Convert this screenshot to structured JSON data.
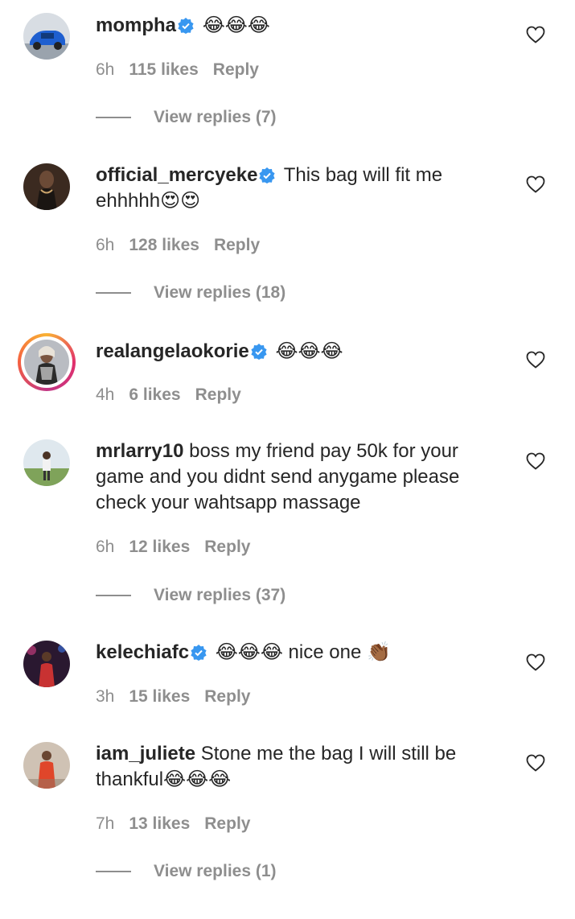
{
  "comments": [
    {
      "username": "mompha",
      "verified": true,
      "text": "😂😂😂",
      "time": "6h",
      "likes": "115 likes",
      "reply": "Reply",
      "view_replies": "View replies (7)"
    },
    {
      "username": "official_mercyeke",
      "verified": true,
      "text": "This bag will fit me ehhhhh😍😍",
      "time": "6h",
      "likes": "128 likes",
      "reply": "Reply",
      "view_replies": "View replies (18)"
    },
    {
      "username": "realangelaokorie",
      "verified": true,
      "text": "😂😂😂",
      "time": "4h",
      "likes": "6 likes",
      "reply": "Reply"
    },
    {
      "username": "mrlarry10",
      "verified": false,
      "text": "boss my friend pay 50k for your game and you didnt send anygame please check your wahtsapp massage",
      "time": "6h",
      "likes": "12 likes",
      "reply": "Reply",
      "view_replies": "View replies (37)"
    },
    {
      "username": "kelechiafc",
      "verified": true,
      "text": "😂😂😂 nice one 👏🏾",
      "time": "3h",
      "likes": "15 likes",
      "reply": "Reply"
    },
    {
      "username": "iam_juliete",
      "verified": false,
      "text": "Stone me the bag I will still be thankful😂😂😂",
      "time": "7h",
      "likes": "13 likes",
      "reply": "Reply",
      "view_replies": "View replies (1)"
    }
  ],
  "colors": {
    "text": "#262626",
    "muted": "#8e8e8e",
    "verified_blue": "#3897f0"
  }
}
